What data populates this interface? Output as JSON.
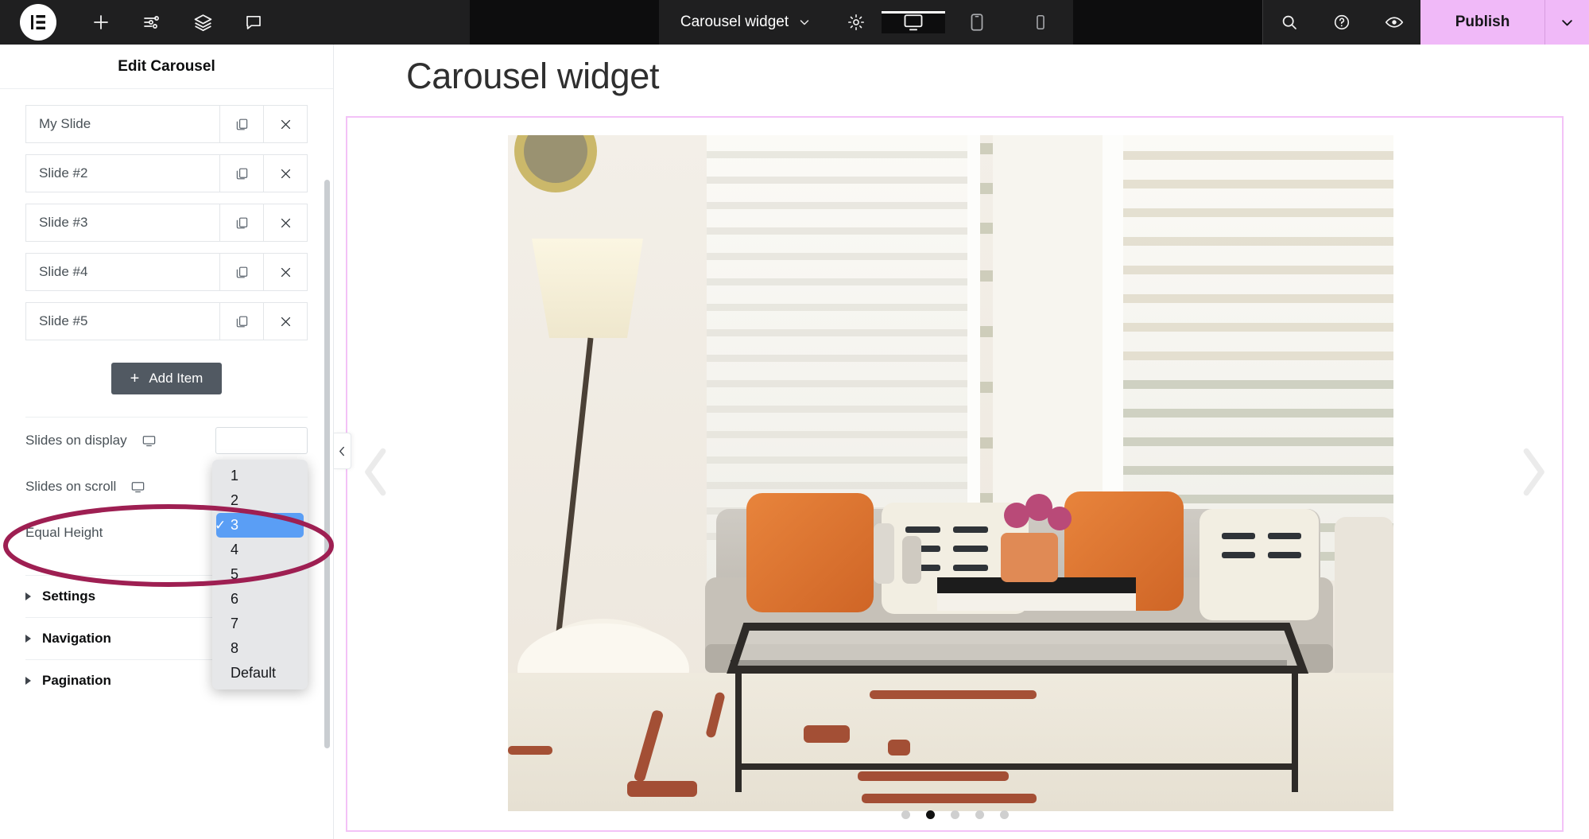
{
  "topbar": {
    "logo_icon": "elementor-logo-icon",
    "add_icon": "plus-icon",
    "settings_sliders_icon": "sliders-icon",
    "layers_icon": "layers-icon",
    "comment_icon": "comment-bubble-icon",
    "widget_name": "Carousel widget",
    "widget_caret_icon": "chevron-down-icon",
    "page_settings_icon": "gear-icon",
    "devices": [
      {
        "name": "desktop",
        "icon": "desktop-icon",
        "active": true
      },
      {
        "name": "tablet",
        "icon": "tablet-icon",
        "active": false
      },
      {
        "name": "mobile",
        "icon": "mobile-icon",
        "active": false
      }
    ],
    "search_icon": "search-icon",
    "help_icon": "question-circle-icon",
    "preview_icon": "eye-icon",
    "publish_label": "Publish",
    "publish_caret_icon": "chevron-down-icon",
    "publish_color": "#f0b9f8"
  },
  "panel": {
    "title": "Edit Carousel",
    "slides": [
      {
        "label": "My Slide",
        "duplicate_icon": "copy-icon",
        "remove_icon": "close-x-icon"
      },
      {
        "label": "Slide #2",
        "duplicate_icon": "copy-icon",
        "remove_icon": "close-x-icon"
      },
      {
        "label": "Slide #3",
        "duplicate_icon": "copy-icon",
        "remove_icon": "close-x-icon"
      },
      {
        "label": "Slide #4",
        "duplicate_icon": "copy-icon",
        "remove_icon": "close-x-icon"
      },
      {
        "label": "Slide #5",
        "duplicate_icon": "copy-icon",
        "remove_icon": "close-x-icon"
      }
    ],
    "add_item_label": "Add Item",
    "add_item_plus": "+",
    "controls": [
      {
        "label": "Slides on display",
        "device_icon": "desktop-icon"
      },
      {
        "label": "Slides on scroll",
        "device_icon": "desktop-icon"
      },
      {
        "label": "Equal Height",
        "device_icon": ""
      }
    ],
    "sections": [
      {
        "label": "Settings",
        "caret_icon": "caret-right-icon"
      },
      {
        "label": "Navigation",
        "caret_icon": "caret-right-icon"
      },
      {
        "label": "Pagination",
        "caret_icon": "caret-right-icon"
      }
    ],
    "collapse_handle_icon": "chevron-left-icon"
  },
  "dropdown": {
    "open_for": "Slides on scroll",
    "selected_value": "3",
    "selected_color": "#5a9ef5",
    "check_icon": "checkmark-icon",
    "options": [
      "1",
      "2",
      "3",
      "4",
      "5",
      "6",
      "7",
      "8",
      "Default"
    ]
  },
  "canvas": {
    "heading": "Carousel widget",
    "selection_border_color": "#f3c2f7",
    "prev_arrow_icon": "chevron-left-icon",
    "next_arrow_icon": "chevron-right-icon",
    "slide_image_alt": "living-room-sofa-photo",
    "pagination_dots": 5,
    "active_dot_index": 1
  },
  "annotation": {
    "shape": "ellipse",
    "color": "#9e1f52",
    "targets": "Slides on scroll row and dropdown"
  }
}
